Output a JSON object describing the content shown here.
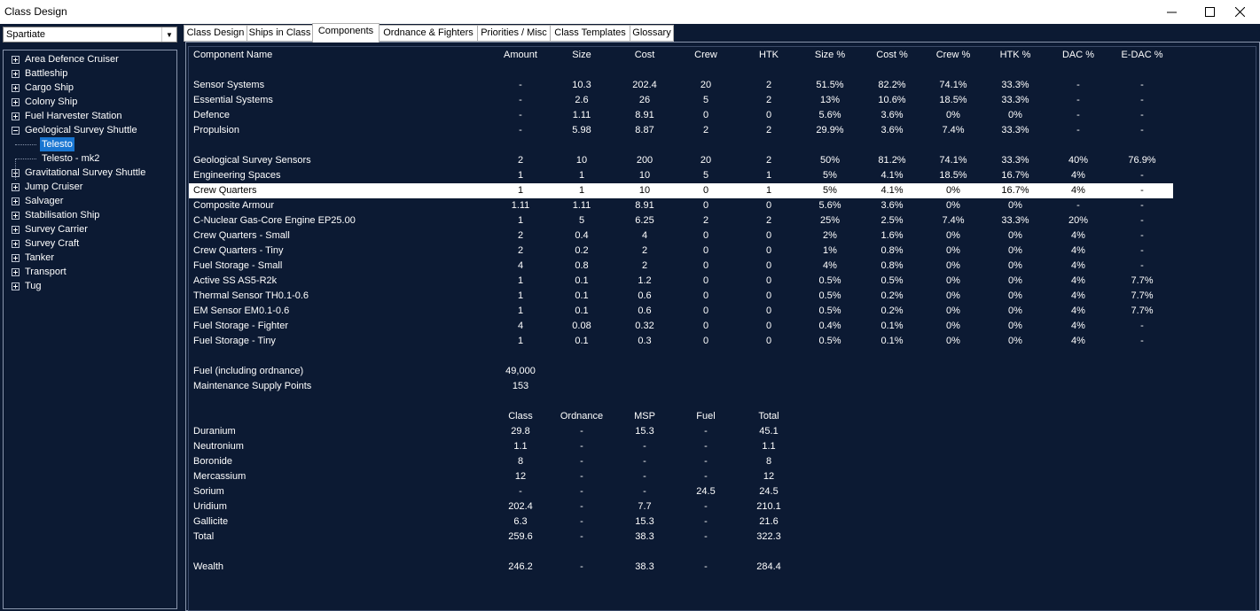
{
  "window": {
    "title": "Class Design",
    "minimize_icon": "minimize-icon",
    "maximize_icon": "maximize-icon",
    "close_icon": "close-icon"
  },
  "race_select": {
    "value": "Spartiate"
  },
  "tree": {
    "nodes": [
      {
        "label": "Area Defence Cruiser",
        "expanded": false
      },
      {
        "label": "Battleship",
        "expanded": false
      },
      {
        "label": "Cargo Ship",
        "expanded": false
      },
      {
        "label": "Colony Ship",
        "expanded": false
      },
      {
        "label": "Fuel Harvester Station",
        "expanded": false
      },
      {
        "label": "Geological Survey Shuttle",
        "expanded": true
      },
      {
        "label": "Telesto",
        "child": true,
        "selected": true
      },
      {
        "label": "Telesto - mk2",
        "child": true
      },
      {
        "label": "Gravitational Survey Shuttle",
        "expanded": false
      },
      {
        "label": "Jump Cruiser",
        "expanded": false
      },
      {
        "label": "Salvager",
        "expanded": false
      },
      {
        "label": "Stabilisation Ship",
        "expanded": false
      },
      {
        "label": "Survey Carrier",
        "expanded": false
      },
      {
        "label": "Survey Craft",
        "expanded": false
      },
      {
        "label": "Tanker",
        "expanded": false
      },
      {
        "label": "Transport",
        "expanded": false
      },
      {
        "label": "Tug",
        "expanded": false
      }
    ]
  },
  "tabs": [
    {
      "label": "Class Design"
    },
    {
      "label": "Ships in Class"
    },
    {
      "label": "Components",
      "active": true
    },
    {
      "label": "Ordnance & Fighters"
    },
    {
      "label": "Priorities / Misc"
    },
    {
      "label": "Class Templates"
    },
    {
      "label": "Glossary"
    }
  ],
  "components": {
    "headers": [
      "Component Name",
      "Amount",
      "Size",
      "Cost",
      "Crew",
      "HTK",
      "Size %",
      "Cost %",
      "Crew %",
      "HTK %",
      "DAC %",
      "E-DAC %"
    ],
    "summary_rows": [
      [
        "Sensor Systems",
        "-",
        "10.3",
        "202.4",
        "20",
        "2",
        "51.5%",
        "82.2%",
        "74.1%",
        "33.3%",
        "-",
        "-"
      ],
      [
        "Essential Systems",
        "-",
        "2.6",
        "26",
        "5",
        "2",
        "13%",
        "10.6%",
        "18.5%",
        "33.3%",
        "-",
        "-"
      ],
      [
        "Defence",
        "-",
        "1.11",
        "8.91",
        "0",
        "0",
        "5.6%",
        "3.6%",
        "0%",
        "0%",
        "-",
        "-"
      ],
      [
        "Propulsion",
        "-",
        "5.98",
        "8.87",
        "2",
        "2",
        "29.9%",
        "3.6%",
        "7.4%",
        "33.3%",
        "-",
        "-"
      ]
    ],
    "selected_row_index": 2,
    "rows": [
      [
        "Geological Survey Sensors",
        "2",
        "10",
        "200",
        "20",
        "2",
        "50%",
        "81.2%",
        "74.1%",
        "33.3%",
        "40%",
        "76.9%"
      ],
      [
        "Engineering Spaces",
        "1",
        "1",
        "10",
        "5",
        "1",
        "5%",
        "4.1%",
        "18.5%",
        "16.7%",
        "4%",
        "-"
      ],
      [
        "Crew Quarters",
        "1",
        "1",
        "10",
        "0",
        "1",
        "5%",
        "4.1%",
        "0%",
        "16.7%",
        "4%",
        "-"
      ],
      [
        "Composite Armour",
        "1.11",
        "1.11",
        "8.91",
        "0",
        "0",
        "5.6%",
        "3.6%",
        "0%",
        "0%",
        "-",
        "-"
      ],
      [
        "C-Nuclear Gas-Core Engine  EP25.00",
        "1",
        "5",
        "6.25",
        "2",
        "2",
        "25%",
        "2.5%",
        "7.4%",
        "33.3%",
        "20%",
        "-"
      ],
      [
        "Crew Quarters - Small",
        "2",
        "0.4",
        "4",
        "0",
        "0",
        "2%",
        "1.6%",
        "0%",
        "0%",
        "4%",
        "-"
      ],
      [
        "Crew Quarters - Tiny",
        "2",
        "0.2",
        "2",
        "0",
        "0",
        "1%",
        "0.8%",
        "0%",
        "0%",
        "4%",
        "-"
      ],
      [
        "Fuel Storage - Small",
        "4",
        "0.8",
        "2",
        "0",
        "0",
        "4%",
        "0.8%",
        "0%",
        "0%",
        "4%",
        "-"
      ],
      [
        "Active SS AS5-R2k",
        "1",
        "0.1",
        "1.2",
        "0",
        "0",
        "0.5%",
        "0.5%",
        "0%",
        "0%",
        "4%",
        "7.7%"
      ],
      [
        "Thermal Sensor TH0.1-0.6",
        "1",
        "0.1",
        "0.6",
        "0",
        "0",
        "0.5%",
        "0.2%",
        "0%",
        "0%",
        "4%",
        "7.7%"
      ],
      [
        "EM Sensor EM0.1-0.6",
        "1",
        "0.1",
        "0.6",
        "0",
        "0",
        "0.5%",
        "0.2%",
        "0%",
        "0%",
        "4%",
        "7.7%"
      ],
      [
        "Fuel Storage - Fighter",
        "4",
        "0.08",
        "0.32",
        "0",
        "0",
        "0.4%",
        "0.1%",
        "0%",
        "0%",
        "4%",
        "-"
      ],
      [
        "Fuel Storage - Tiny",
        "1",
        "0.1",
        "0.3",
        "0",
        "0",
        "0.5%",
        "0.1%",
        "0%",
        "0%",
        "4%",
        "-"
      ]
    ]
  },
  "supply": [
    [
      "Fuel (including ordnance)",
      "49,000"
    ],
    [
      "Maintenance Supply Points",
      "153"
    ]
  ],
  "minerals": {
    "headers": [
      "",
      "Class",
      "Ordnance",
      "MSP",
      "Fuel",
      "Total"
    ],
    "rows": [
      [
        "Duranium",
        "29.8",
        "-",
        "15.3",
        "-",
        "45.1"
      ],
      [
        "Neutronium",
        "1.1",
        "-",
        "-",
        "-",
        "1.1"
      ],
      [
        "Boronide",
        "8",
        "-",
        "-",
        "-",
        "8"
      ],
      [
        "Mercassium",
        "12",
        "-",
        "-",
        "-",
        "12"
      ],
      [
        "Sorium",
        "-",
        "-",
        "-",
        "24.5",
        "24.5"
      ],
      [
        "Uridium",
        "202.4",
        "-",
        "7.7",
        "-",
        "210.1"
      ],
      [
        "Gallicite",
        "6.3",
        "-",
        "15.3",
        "-",
        "21.6"
      ],
      [
        "Total",
        "259.6",
        "-",
        "38.3",
        "-",
        "322.3"
      ]
    ],
    "wealth": [
      "Wealth",
      "246.2",
      "-",
      "38.3",
      "-",
      "284.4"
    ]
  }
}
